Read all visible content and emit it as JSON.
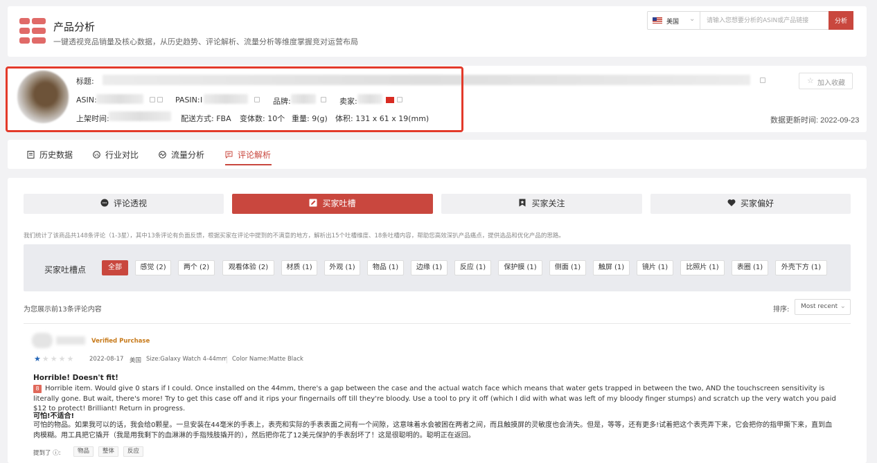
{
  "header": {
    "title": "产品分析",
    "subtitle": "一键透视竞品销量及核心数据，从历史趋势、评论解析、流量分析等维度掌握竞对运营布局",
    "country": "美国",
    "search_placeholder": "请输入您想要分析的ASIN或产品链接",
    "search_button": "分析"
  },
  "product": {
    "title_label": "标题:",
    "asin_label": "ASIN:",
    "pasin_label": "PASIN:",
    "pasin_prefix": "I",
    "brand_label": "品牌:",
    "seller_label": "卖家:",
    "listed_label": "上架时间:",
    "shipping": "配送方式: FBA",
    "variants": "变体数: 10个",
    "weight": "重量: 9(g)",
    "volume": "体积: 131 x 61 x 19(mm)",
    "favorite_button": "加入收藏",
    "updated": "数据更新时间: 2022-09-23"
  },
  "tabs": [
    {
      "label": "历史数据"
    },
    {
      "label": "行业对比"
    },
    {
      "label": "流量分析"
    },
    {
      "label": "评论解析"
    }
  ],
  "subtabs": [
    {
      "label": "评论透视"
    },
    {
      "label": "买家吐槽"
    },
    {
      "label": "买家关注"
    },
    {
      "label": "买家偏好"
    }
  ],
  "description": "我们统计了该商品共148条评论（1-3星），其中13条评论有负面反馈，根据买家在评论中提到的不满意的地方，解析出15个吐槽维度、18条吐槽内容，帮助您高效深扒产品痛点，提供选品和优化产品的思路。",
  "filter": {
    "label": "买家吐槽点",
    "chips": [
      "全部",
      "感觉 (2)",
      "两个 (2)",
      "观看体验 (2)",
      "材质 (1)",
      "外观 (1)",
      "物品 (1)",
      "边缘 (1)",
      "反应 (1)",
      "保护膜 (1)",
      "侧面 (1)",
      "触屏 (1)",
      "镜片 (1)",
      "比照片 (1)",
      "表圈 (1)",
      "外壳下方 (1)"
    ]
  },
  "list": {
    "count_text": "为您展示前13条评论内容",
    "sort_label": "排序:",
    "sort_value": "Most recent"
  },
  "review": {
    "verified": "Verified Purchase",
    "rating": 1,
    "date": "2022-08-17",
    "country": "美国",
    "size": "Size:Galaxy Watch 4-44mm",
    "color": "Color Name:Matte Black",
    "title": "Horrible! Doesn't fit!",
    "badge": "8",
    "body": "Horrible item. Would give 0 stars if I could. Once installed on the 44mm, there's a gap between the case and the actual watch face which means that water gets trapped in between the two, AND the touchscreen sensitivity is literally gone. But wait, there's more! Try to get this case off and it rips your fingernails off till they're bloody. Use a tool to pry it off (which I did with what was left of my bloody finger stumps) and scratch up the very watch you paid $12 to protect! Brilliant! Return in progress.",
    "title_cn": "可怕!不适合!",
    "body_cn": "可怕的物品。如果我可以的话，我会给0颗星。一旦安装在44毫米的手表上，表壳和实际的手表表面之间有一个间隙，这意味着水会被困在两者之间，而且触摸屏的灵敏度也会消失。但是，等等，还有更多!试着把这个表壳弄下来，它会把你的指甲撕下来，直到血肉模糊。用工具把它撬开（我是用我剩下的血淋淋的手指残肢撬开的），然后把你花了12美元保护的手表刮坏了！这是很聪明的。聪明正在返回。",
    "mentioned_label": "提到了",
    "tags": [
      "物品",
      "整体",
      "反应"
    ]
  }
}
